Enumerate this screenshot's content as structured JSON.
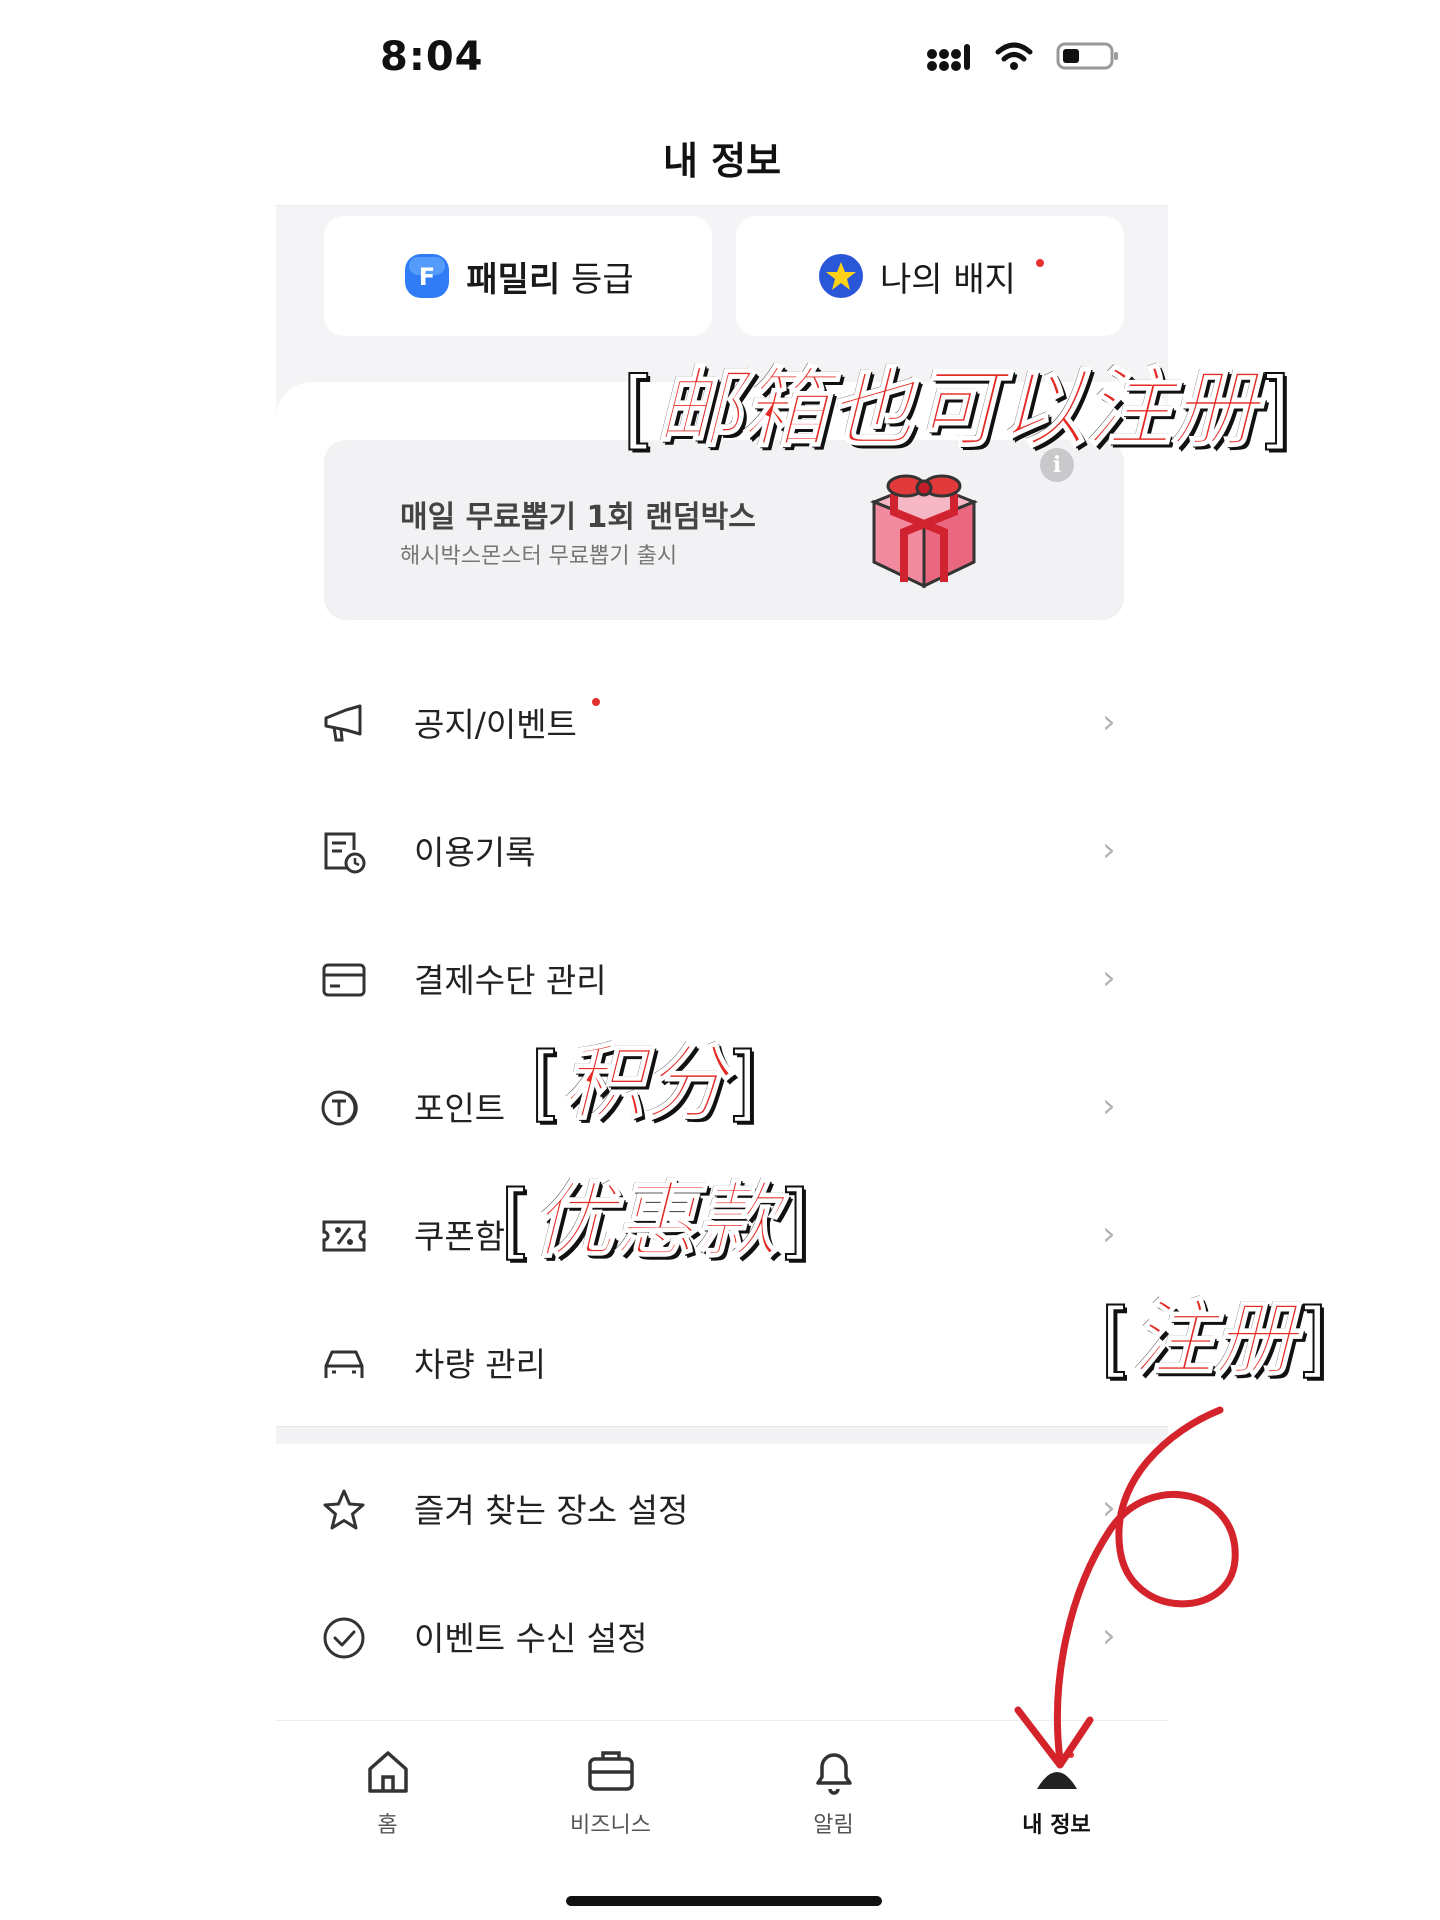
{
  "status_bar": {
    "time": "8:04"
  },
  "header": {
    "title": "내 정보"
  },
  "top_cards": {
    "family": {
      "badge_letter": "F",
      "label_bold": "패밀리",
      "label_rest": " 등급"
    },
    "badge": {
      "label": "나의 배지"
    }
  },
  "banner": {
    "title": "매일 무료뽑기 1회 랜덤박스",
    "subtitle": "해시박스몬스터 무료뽑기 출시",
    "info_glyph": "i"
  },
  "menu": {
    "items": [
      {
        "label": "공지/이벤트",
        "icon": "megaphone-icon"
      },
      {
        "label": "이용기록",
        "icon": "history-icon"
      },
      {
        "label": "결제수단 관리",
        "icon": "card-icon"
      },
      {
        "label": "포인트",
        "icon": "coin-icon"
      },
      {
        "label": "쿠폰함",
        "icon": "coupon-icon"
      },
      {
        "label": "차량 관리",
        "icon": "car-icon"
      }
    ],
    "settings": [
      {
        "label": "즐겨 찾는 장소 설정",
        "icon": "star-icon"
      },
      {
        "label": "이벤트 수신 설정",
        "icon": "check-circle-icon"
      }
    ],
    "chevron": "›"
  },
  "tab_bar": {
    "tabs": [
      {
        "label": "홈",
        "icon": "home-icon"
      },
      {
        "label": "비즈니스",
        "icon": "briefcase-icon"
      },
      {
        "label": "알림",
        "icon": "bell-icon"
      },
      {
        "label": "내 정보",
        "icon": "person-icon",
        "active": true
      }
    ]
  },
  "annotations": {
    "email": "邮箱也可以注册",
    "points": "积分",
    "coupons": "优惠款",
    "register": "注册",
    "bracket_open": "[",
    "bracket_close": "]"
  },
  "colors": {
    "accent_red": "#e42a25",
    "notify_dot": "#e53030",
    "badge_blue": "#2f7cf6"
  }
}
